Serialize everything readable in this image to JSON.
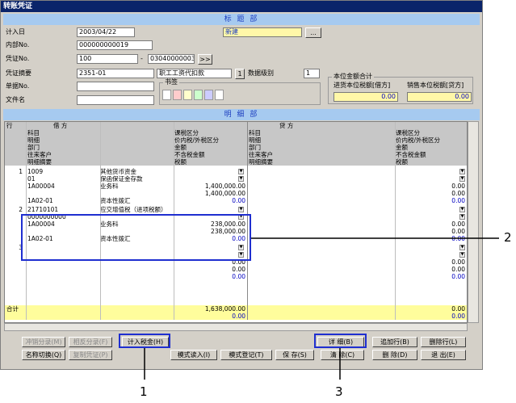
{
  "window": {
    "title": "转账凭证"
  },
  "header_band": "标 题 部",
  "detail_band": "明 细 部",
  "form": {
    "entry_date_label": "计入日",
    "entry_date": "2003/04/22",
    "status_value": "新建",
    "browse_btn": "...",
    "internal_no_label": "内部No.",
    "internal_no": "000000000019",
    "voucher_no_label": "凭证No.",
    "voucher_no_from": "100",
    "voucher_no_sep": "-",
    "voucher_no_to": "03040000003",
    "voucher_nav_btn": ">>",
    "summary_label": "凭证摘要",
    "summary_code": "2351-01",
    "summary_text": "职工工资代扣款",
    "summary_num_btn": "1",
    "data_level_label": "数据级别",
    "data_level": "1",
    "doc_no_label": "单据No.",
    "doc_no": "",
    "file_name_label": "文件名",
    "file_name": "",
    "bookmark_label": "书签",
    "bookmark_colors": [
      "#ffffff",
      "#ffcccc",
      "#ffffcc",
      "#ccffcc",
      "#ccccff",
      "#ffffff"
    ]
  },
  "totals": {
    "group_label": "本位金额合计",
    "purchase_label": "进货本位税额[借方]",
    "purchase_value": "0.00",
    "sales_label": "销售本位税额[贷方]",
    "sales_value": "0.00"
  },
  "grid": {
    "header": {
      "row_col": "行",
      "debit": "借    方",
      "credit": "贷    方",
      "left_lines": [
        "科目",
        "明细",
        "部门",
        "往来客户",
        "明细摘要"
      ],
      "mid_lines": [
        "课税区分",
        "价内税/外税区分",
        "金额",
        "不含税金额",
        "税额"
      ],
      "right_lines": [
        "科目",
        "明细",
        "部门",
        "往来客户",
        "明细摘要"
      ],
      "far_lines": [
        "课税区分",
        "价内税/外税区分",
        "金额",
        "不含税金额",
        "税额"
      ]
    },
    "entries": [
      {
        "no": "1",
        "account_code": "1009",
        "account_name": "其他货币资金",
        "detail_code": "01",
        "detail_name": "保函保证金存款",
        "dept_code": "1A00004",
        "dept_name": "业务科",
        "amount": "1,400,000.00",
        "amount_ex_tax": "1,400,000.00",
        "memo_code": "1A02-01",
        "memo_text": "资本性拨汇",
        "tax": "0.00",
        "credit_amount": "0.00",
        "credit_ex_tax": "0.00",
        "credit_tax": "0.00"
      },
      {
        "no": "2",
        "account_code": "21710101",
        "account_name": "应交增值税（进项税额）",
        "detail_code": "0000000000",
        "detail_name": "",
        "dept_code": "1A00004",
        "dept_name": "业务科",
        "amount": "238,000.00",
        "amount_ex_tax": "238,000.00",
        "memo_code": "1A02-01",
        "memo_text": "资本性拨汇",
        "tax": "0.00",
        "credit_amount": "0.00",
        "credit_ex_tax": "0.00",
        "credit_tax": "0.00"
      },
      {
        "no": "3",
        "amount": "0.00",
        "amount_ex_tax": "0.00",
        "tax": "0.00",
        "credit_amount": "0.00",
        "credit_ex_tax": "0.00",
        "credit_tax": "0.00"
      }
    ],
    "total_label": "合计",
    "total_debit": "1,638,000.00",
    "total_debit_tax": "0.00",
    "total_credit": "0.00",
    "total_credit_tax": "0.00"
  },
  "buttons": {
    "offset_entry": "冲销分录(M)",
    "reverse_entry": "相反分录(F)",
    "calc_tax": "计入税金(H)",
    "detail": "详  细(B)",
    "add_row": "追加行(B)",
    "delete_row": "删除行(L)",
    "name_switch": "名称切换(Q)",
    "copy_voucher": "复制凭证(P)",
    "pattern_load": "模式读入(I)",
    "pattern_register": "模式登记(T)",
    "save": "保  存(S)",
    "clear": "清  除(C)",
    "delete": "删  除(D)",
    "exit": "退  出(E)"
  },
  "callouts": {
    "one": "1",
    "two": "2",
    "three": "3"
  }
}
